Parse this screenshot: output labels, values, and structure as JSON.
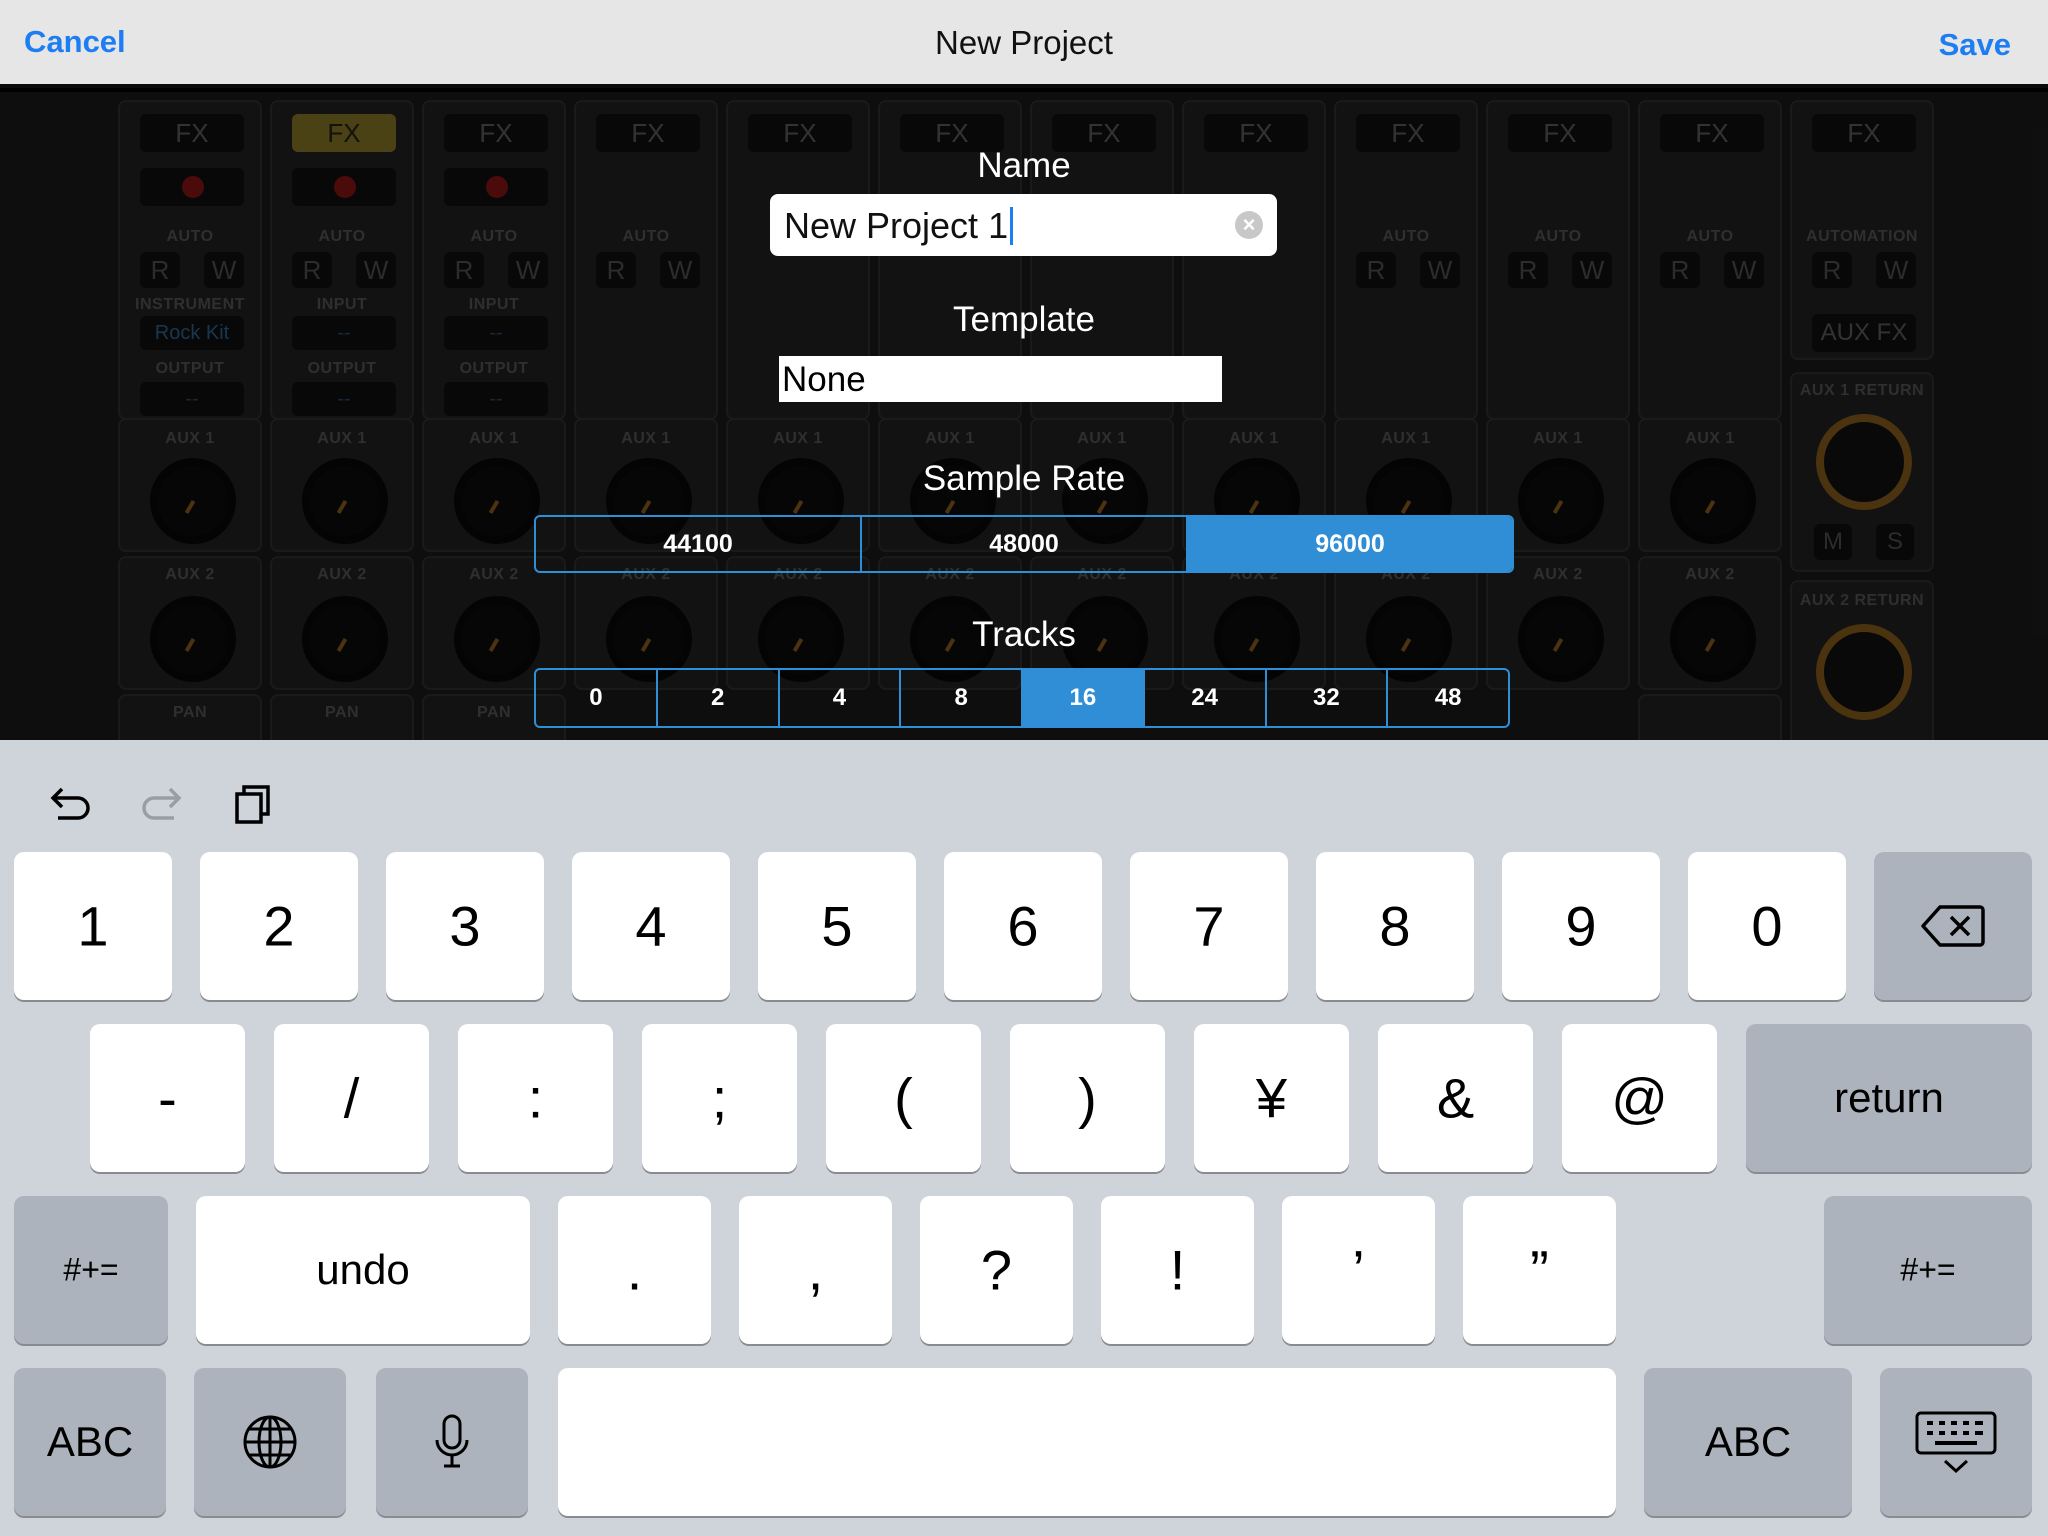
{
  "navbar": {
    "cancel": "Cancel",
    "title": "New Project",
    "save": "Save"
  },
  "mixer": {
    "fx": "FX",
    "auto": "AUTO",
    "automation": "AUTOMATION",
    "r": "R",
    "w": "W",
    "instrument": "INSTRUMENT",
    "input": "INPUT",
    "output": "OUTPUT",
    "rock_kit": "Rock Kit",
    "dash": "--",
    "aux_fx": "AUX FX",
    "aux1": "AUX 1",
    "aux2": "AUX 2",
    "pan": "PAN",
    "aux1_return": "AUX 1 RETURN",
    "aux2_return": "AUX 2 RETURN",
    "m": "M",
    "s": "S"
  },
  "dialog": {
    "name_label": "Name",
    "name_value": "New Project 1",
    "template_label": "Template",
    "template_value": "None",
    "sample_rate_label": "Sample Rate",
    "sample_rates": [
      "44100",
      "48000",
      "96000"
    ],
    "sample_rate_selected": "96000",
    "tracks_label": "Tracks",
    "tracks": [
      "0",
      "2",
      "4",
      "8",
      "16",
      "24",
      "32",
      "48"
    ],
    "tracks_selected": "16"
  },
  "keyboard": {
    "toolbar": [
      "undo-icon",
      "redo-icon",
      "paste-icon"
    ],
    "row1": [
      "1",
      "2",
      "3",
      "4",
      "5",
      "6",
      "7",
      "8",
      "9",
      "0"
    ],
    "row2": [
      "-",
      "/",
      ":",
      ";",
      "(",
      ")",
      "¥",
      "&",
      "@"
    ],
    "return": "return",
    "symbols": "#+=",
    "undo": "undo",
    "row3": [
      ".",
      ",",
      "?",
      "!",
      "’",
      "”"
    ],
    "abc": "ABC"
  }
}
